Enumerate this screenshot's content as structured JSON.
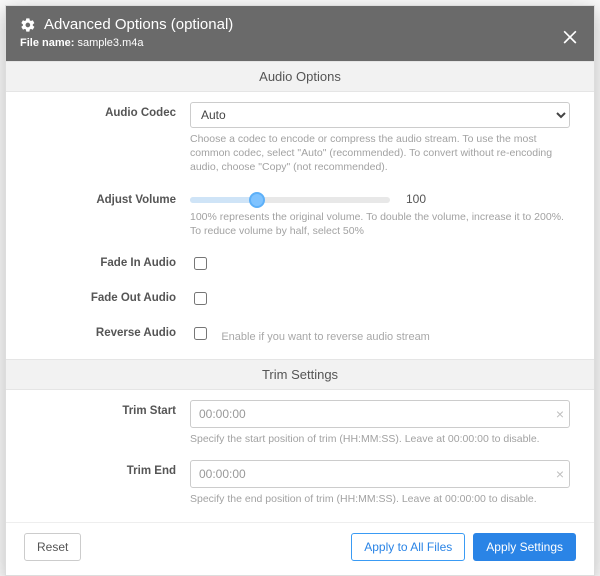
{
  "header": {
    "title": "Advanced Options (optional)",
    "filename_label": "File name:",
    "filename_value": "sample3.m4a"
  },
  "audio": {
    "section_title": "Audio Options",
    "codec": {
      "label": "Audio Codec",
      "value": "Auto",
      "help": "Choose a codec to encode or compress the audio stream. To use the most common codec, select \"Auto\" (recommended). To convert without re-encoding audio, choose \"Copy\" (not recommended)."
    },
    "volume": {
      "label": "Adjust Volume",
      "value": 100,
      "min": 0,
      "max": 300,
      "help": "100% represents the original volume. To double the volume, increase it to 200%. To reduce volume by half, select 50%"
    },
    "fade_in": {
      "label": "Fade In Audio",
      "checked": false
    },
    "fade_out": {
      "label": "Fade Out Audio",
      "checked": false
    },
    "reverse": {
      "label": "Reverse Audio",
      "checked": false,
      "inline_help": "Enable if you want to reverse audio stream"
    }
  },
  "trim": {
    "section_title": "Trim Settings",
    "start": {
      "label": "Trim Start",
      "value": "00:00:00",
      "help": "Specify the start position of trim (HH:MM:SS). Leave at 00:00:00 to disable."
    },
    "end": {
      "label": "Trim End",
      "value": "00:00:00",
      "help": "Specify the end position of trim (HH:MM:SS). Leave at 00:00:00 to disable."
    }
  },
  "footer": {
    "reset": "Reset",
    "apply_all": "Apply to All Files",
    "apply": "Apply Settings"
  },
  "colors": {
    "header_bg": "#6a6a6a",
    "primary": "#2a84e6",
    "help_text": "#a2a2a2"
  }
}
